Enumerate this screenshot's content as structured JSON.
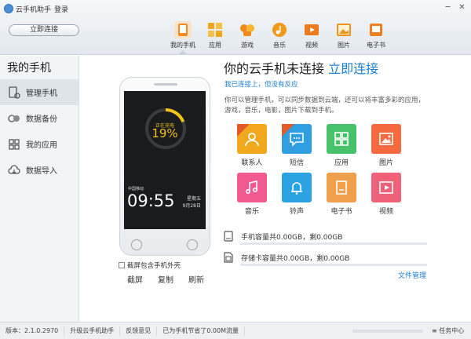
{
  "window": {
    "app_title": "云手机助手",
    "login": "登录",
    "minimize": "─",
    "close": "✕"
  },
  "toolbar": {
    "connect_button": "立即连接",
    "nav": [
      {
        "label": "我的手机",
        "icon": "phone-icon",
        "color": "#f08a24",
        "active": true
      },
      {
        "label": "应用",
        "icon": "apps-icon",
        "color": "#f2a51d"
      },
      {
        "label": "游戏",
        "icon": "gamepad-icon",
        "color": "#f28b1d"
      },
      {
        "label": "音乐",
        "icon": "music-icon",
        "color": "#f0991b"
      },
      {
        "label": "视频",
        "icon": "video-icon",
        "color": "#ef7a1e"
      },
      {
        "label": "图片",
        "icon": "picture-icon",
        "color": "#f0931c"
      },
      {
        "label": "电子书",
        "icon": "ebook-icon",
        "color": "#ee7f22"
      }
    ]
  },
  "sidebar": {
    "title": "我的手机",
    "items": [
      {
        "label": "管理手机",
        "icon": "manage-phone-icon",
        "active": true
      },
      {
        "label": "数据备份",
        "icon": "backup-icon"
      },
      {
        "label": "我的应用",
        "icon": "my-apps-icon"
      },
      {
        "label": "数据导入",
        "icon": "cloud-import-icon"
      }
    ]
  },
  "phone": {
    "charge_label": "正在充电",
    "charge_percent": "19%",
    "charge_level": 0.19,
    "carrier": "中国移动",
    "time": "09:55",
    "weekday": "星期五",
    "date": "9月28日",
    "shell_option": "截屏包含手机外壳",
    "actions": [
      "截屏",
      "复制",
      "刷新"
    ]
  },
  "main": {
    "headline": "你的云手机未连接",
    "headline_link": "立即连接",
    "sub_link": "我已连接上，但没有反应",
    "description": "你可以管理手机，可以同步数据到云端，还可以将丰富多彩的应用，游戏，音乐，电影，图片下载到手机。",
    "tiles": [
      {
        "label": "联系人",
        "icon": "contacts-icon",
        "color": "#f2a81d",
        "badge": true
      },
      {
        "label": "短信",
        "icon": "sms-icon",
        "color": "#2f9fe2",
        "badge": true
      },
      {
        "label": "应用",
        "icon": "apps-icon",
        "color": "#48c26a"
      },
      {
        "label": "图片",
        "icon": "picture-icon",
        "color": "#f46a3e"
      },
      {
        "label": "音乐",
        "icon": "music-icon",
        "color": "#f05a8e"
      },
      {
        "label": "铃声",
        "icon": "bell-icon",
        "color": "#2ba3e3"
      },
      {
        "label": "电子书",
        "icon": "ebook-icon",
        "color": "#f0a04a"
      },
      {
        "label": "视频",
        "icon": "video-icon",
        "color": "#ef6179"
      }
    ],
    "storage": [
      {
        "label": "手机容量共0.00GB，剩0.00GB",
        "icon": "phone-storage-icon",
        "used": 0
      },
      {
        "label": "存储卡容量共0.00GB，剩0.00GB",
        "icon": "sd-card-icon",
        "used": 0
      }
    ],
    "file_manager": "文件管理"
  },
  "status": {
    "version": "版本：2.1.0.2970",
    "upgrade": "升级云手机助手",
    "feedback": "反馈意见",
    "saved": "已为手机节省了0.00M流量",
    "tasks": "任务中心"
  }
}
